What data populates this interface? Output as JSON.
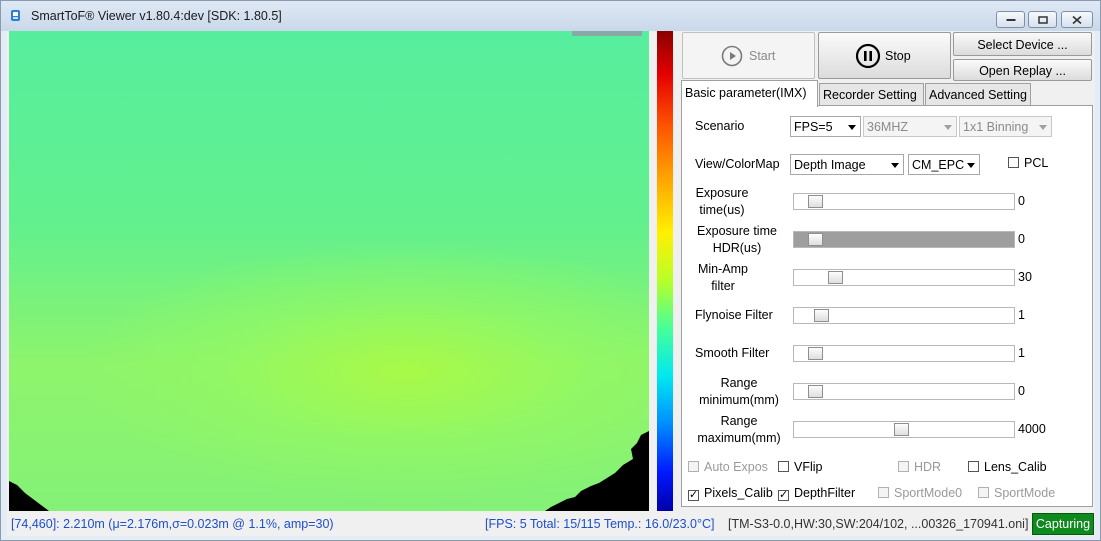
{
  "window": {
    "title": "SmartToF® Viewer v1.80.4:dev [SDK: 1.80.5]"
  },
  "colors": {
    "status_text": "#1d4fcc",
    "capturing_bg": "#0f8a1f"
  },
  "controls": {
    "start_label": "Start",
    "stop_label": "Stop",
    "select_device_label": "Select Device ...",
    "open_replay_label": "Open Replay ..."
  },
  "tabs": [
    {
      "label": "Basic parameter(IMX)",
      "active": true
    },
    {
      "label": "Recorder Setting",
      "active": false
    },
    {
      "label": "Advanced Setting",
      "active": false
    }
  ],
  "basic": {
    "scenario_label": "Scenario",
    "fps_value": "FPS=5",
    "freq_value": "36MHZ",
    "binning_value": "1x1 Binning",
    "view_label": "View/ColorMap",
    "view_value": "Depth Image",
    "colormap_value": "CM_EPC",
    "pcl_label": "PCL",
    "sliders": [
      {
        "label": "Exposure time(us)",
        "value": "0",
        "level": 0.0
      },
      {
        "label": "Exposure time HDR(us)",
        "value": "0",
        "level": 0.0
      },
      {
        "label": "Min-Amp filter",
        "value": "30",
        "level": 0.12
      },
      {
        "label": "Flynoise Filter",
        "value": "1",
        "level": 0.05
      },
      {
        "label": "Smooth Filter",
        "value": "1",
        "level": 0.0
      },
      {
        "label": "Range minimum(mm)",
        "value": "0",
        "level": 0.0
      },
      {
        "label": "Range maximum(mm)",
        "value": "4000",
        "level": 0.45
      }
    ],
    "checkboxes_row1": [
      {
        "label": "Auto Expos",
        "checked": false,
        "enabled": false
      },
      {
        "label": "VFlip",
        "checked": false,
        "enabled": true
      },
      {
        "label": "HDR",
        "checked": false,
        "enabled": false
      },
      {
        "label": "Lens_Calib",
        "checked": false,
        "enabled": true
      }
    ],
    "checkboxes_row2": [
      {
        "label": "Pixels_Calib",
        "checked": true,
        "enabled": true
      },
      {
        "label": "DepthFilter",
        "checked": true,
        "enabled": true
      },
      {
        "label": "SportMode0",
        "checked": false,
        "enabled": false
      },
      {
        "label": "SportMode",
        "checked": false,
        "enabled": false
      }
    ]
  },
  "status": {
    "pixel_info": "[74,460]: 2.210m (μ=2.176m,σ=0.023m @ 1.1%, amp=30)",
    "fps_info": "[FPS: 5 Total: 15/115 Temp.: 16.0/23.0°C]",
    "device_info": "[TM-S3-0.0,HW:30,SW:204/102, ...00326_170941.oni]",
    "capturing": "Capturing"
  }
}
